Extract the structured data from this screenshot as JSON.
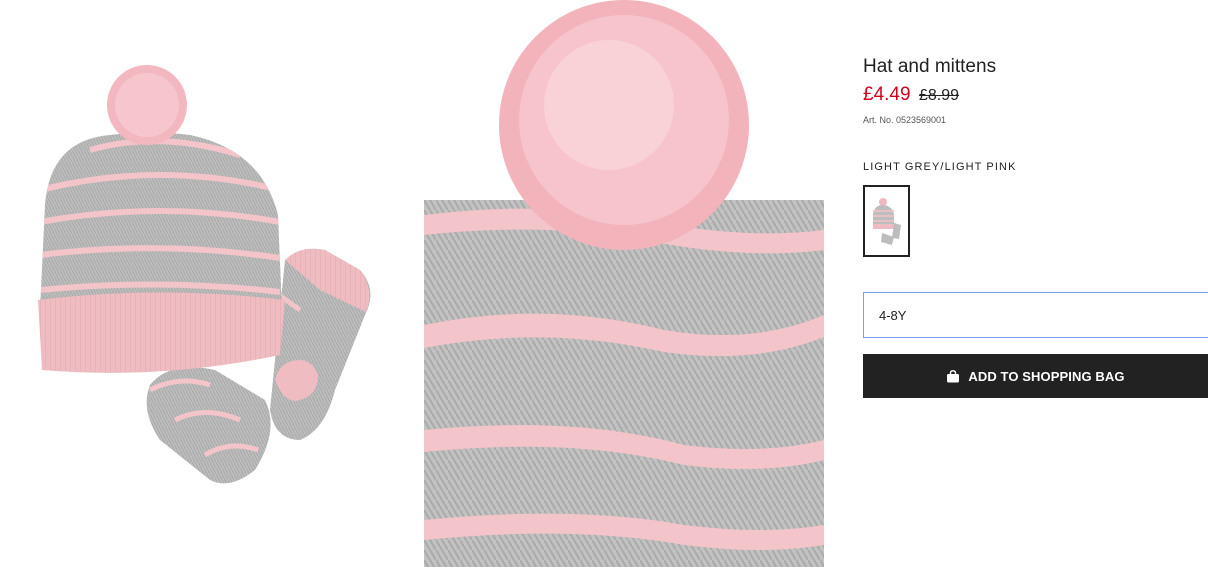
{
  "product": {
    "name": "Hat and mittens",
    "price_sale": "£4.49",
    "price_original": "£8.99",
    "article_number": "Art. No. 0523569001",
    "color_name": "LIGHT GREY/LIGHT PINK",
    "selected_size": "4-8Y",
    "add_to_bag_label": "ADD TO SHOPPING BAG"
  },
  "colors": {
    "sale_price": "#d0021b",
    "button_bg": "#222222",
    "field_border": "#7a9ff0",
    "knit_grey": "#b9b9b9",
    "knit_pink": "#f3c4c9"
  },
  "icons": {
    "add_to_bag": "shopping-bag-icon"
  }
}
